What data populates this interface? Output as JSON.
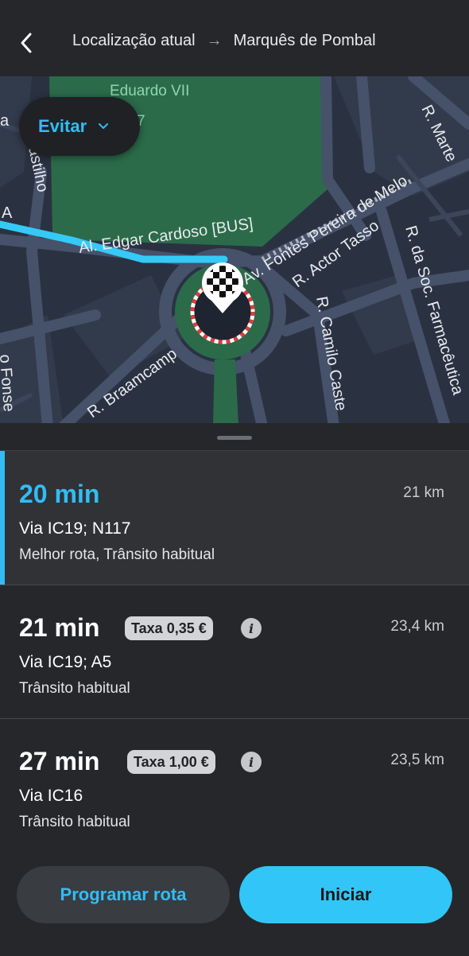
{
  "header": {
    "back_icon": "chevron-left-icon",
    "origin": "Localização atual",
    "arrow": "→",
    "destination": "Marquês de Pombal"
  },
  "map": {
    "avoid_label": "Evitar",
    "labels": {
      "park": "Eduardo VII",
      "park_digit": "7",
      "edgar": "Al. Edgar Cardoso [BUS]",
      "fontes": "Av. Fontes Pereira de Melo",
      "tasso": "R. Actor Tasso",
      "farmaceutica": "R. da Soc. Farmacêutica",
      "camilo": "R. Camilo Caste",
      "braamcamp": "R. Braamcamp",
      "martens": "R. Marte",
      "castilho": "astilho",
      "fonseca": "o Fonse",
      "a_left": "A",
      "a_top": "a"
    },
    "colors": {
      "route": "#35c9f7",
      "park": "#2b6b4a",
      "roads": "#4a5569"
    }
  },
  "routes": [
    {
      "time": "20 min",
      "distance": "21 km",
      "via": "Via IC19; N117",
      "traffic": "Melhor rota, Trânsito habitual",
      "toll": null
    },
    {
      "time": "21 min",
      "distance": "23,4 km",
      "via": "Via IC19; A5",
      "traffic": "Trânsito habitual",
      "toll": "Taxa 0,35 €"
    },
    {
      "time": "27 min",
      "distance": "23,5 km",
      "via": "Via IC16",
      "traffic": "Trânsito habitual",
      "toll": "Taxa 1,00 €"
    }
  ],
  "info_glyph": "i",
  "actions": {
    "schedule_label": "Programar rota",
    "start_label": "Iniciar"
  },
  "colors": {
    "accent": "#31bdf4",
    "background": "#25272b"
  }
}
